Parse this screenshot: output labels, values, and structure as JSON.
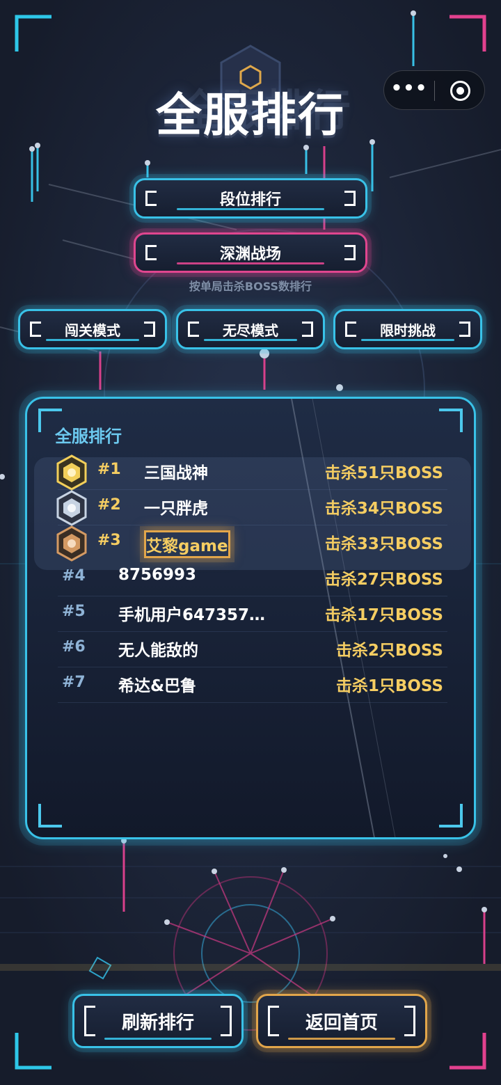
{
  "header": {
    "title": "全服排行",
    "capsule": {
      "more_icon": "more-icon",
      "more_glyph": "•••",
      "close_icon": "target-icon"
    }
  },
  "category_tabs": [
    {
      "label": "段位排行",
      "color": "#39c2e8",
      "active": false
    },
    {
      "label": "深渊战场",
      "color": "#e0468f",
      "active": true
    }
  ],
  "subtitle": "按单局击杀BOSS数排行",
  "mode_tabs": [
    {
      "label": "闯关模式",
      "active": false
    },
    {
      "label": "无尽模式",
      "active": false
    },
    {
      "label": "限时挑战",
      "active": false
    }
  ],
  "leaderboard": {
    "title": "全服排行",
    "rows": [
      {
        "rank": "#1",
        "name": "三国战神",
        "score": "击杀51只BOSS",
        "medal": "gold-medal-icon",
        "medal_color": "#f2cf5a"
      },
      {
        "rank": "#2",
        "name": "一只胖虎",
        "score": "击杀34只BOSS",
        "medal": "silver-medal-icon",
        "medal_color": "#c7d3e3"
      },
      {
        "rank": "#3",
        "name": "艾黎game",
        "score": "击杀33只BOSS",
        "medal": "bronze-medal-icon",
        "medal_color": "#d49a63"
      },
      {
        "rank": "#4",
        "name": "8756993",
        "score": "击杀27只BOSS"
      },
      {
        "rank": "#5",
        "name": "手机用户647357…",
        "score": "击杀17只BOSS"
      },
      {
        "rank": "#6",
        "name": "无人能敌的",
        "score": "击杀2只BOSS"
      },
      {
        "rank": "#7",
        "name": "希达&巴鲁",
        "score": "击杀1只BOSS"
      }
    ]
  },
  "footer": {
    "refresh_label": "刷新排行",
    "home_label": "返回首页"
  },
  "colors": {
    "cyan": "#39c2e8",
    "pink": "#e0468f",
    "gold": "#e2a64b",
    "score": "#f5cd62"
  }
}
